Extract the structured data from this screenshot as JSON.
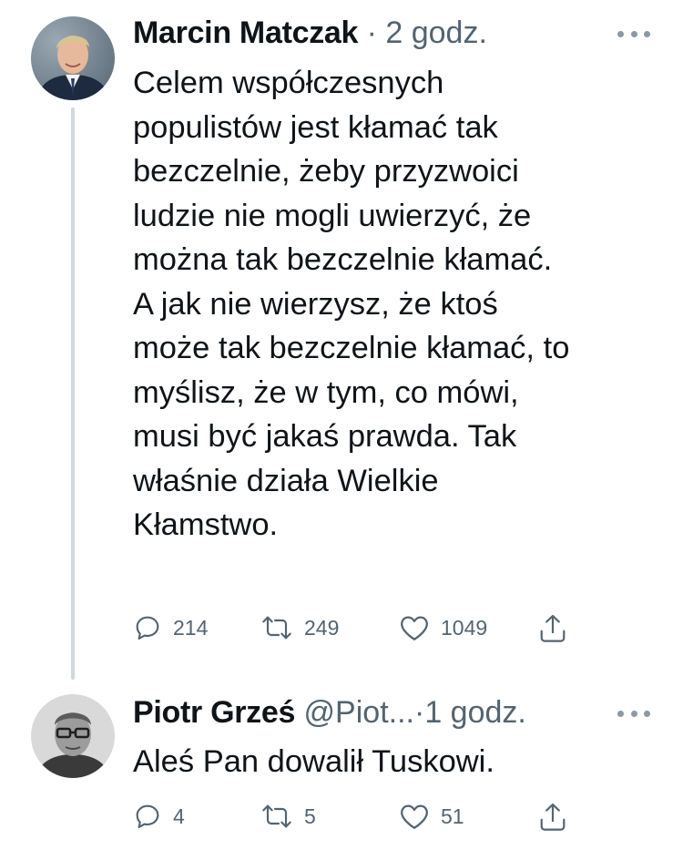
{
  "tweets": [
    {
      "author_name": "Marcin Matczak",
      "separator": "·",
      "time": "2 godz.",
      "text": "Celem współczesnych\npopulistów jest kłamać tak\nbezczelnie, żeby przyzwoici\nludzie nie mogli uwierzyć, że\nmożna tak bezczelnie kłamać.\nA jak nie wierzysz, że ktoś\nmoże tak bezczelnie kłamać, to\nmyślisz, że w tym, co mówi,\nmusi być jakaś prawda. Tak\nwłaśnie działa Wielkie\nKłamstwo.",
      "reply_count": "214",
      "retweet_count": "249",
      "like_count": "1049"
    },
    {
      "author_name": "Piotr Grześ",
      "handle": "@Piot...",
      "separator": "·",
      "time": "1 godz.",
      "text": "Aleś Pan dowalił Tuskowi.",
      "reply_count": "4",
      "retweet_count": "5",
      "like_count": "51"
    }
  ],
  "icons": {
    "reply": "reply-icon",
    "retweet": "retweet-icon",
    "like": "heart-icon",
    "share": "share-icon",
    "more": "more-options-icon"
  },
  "colors": {
    "text": "#0f1419",
    "secondary": "#536471",
    "thread_line": "#cfd9de"
  }
}
